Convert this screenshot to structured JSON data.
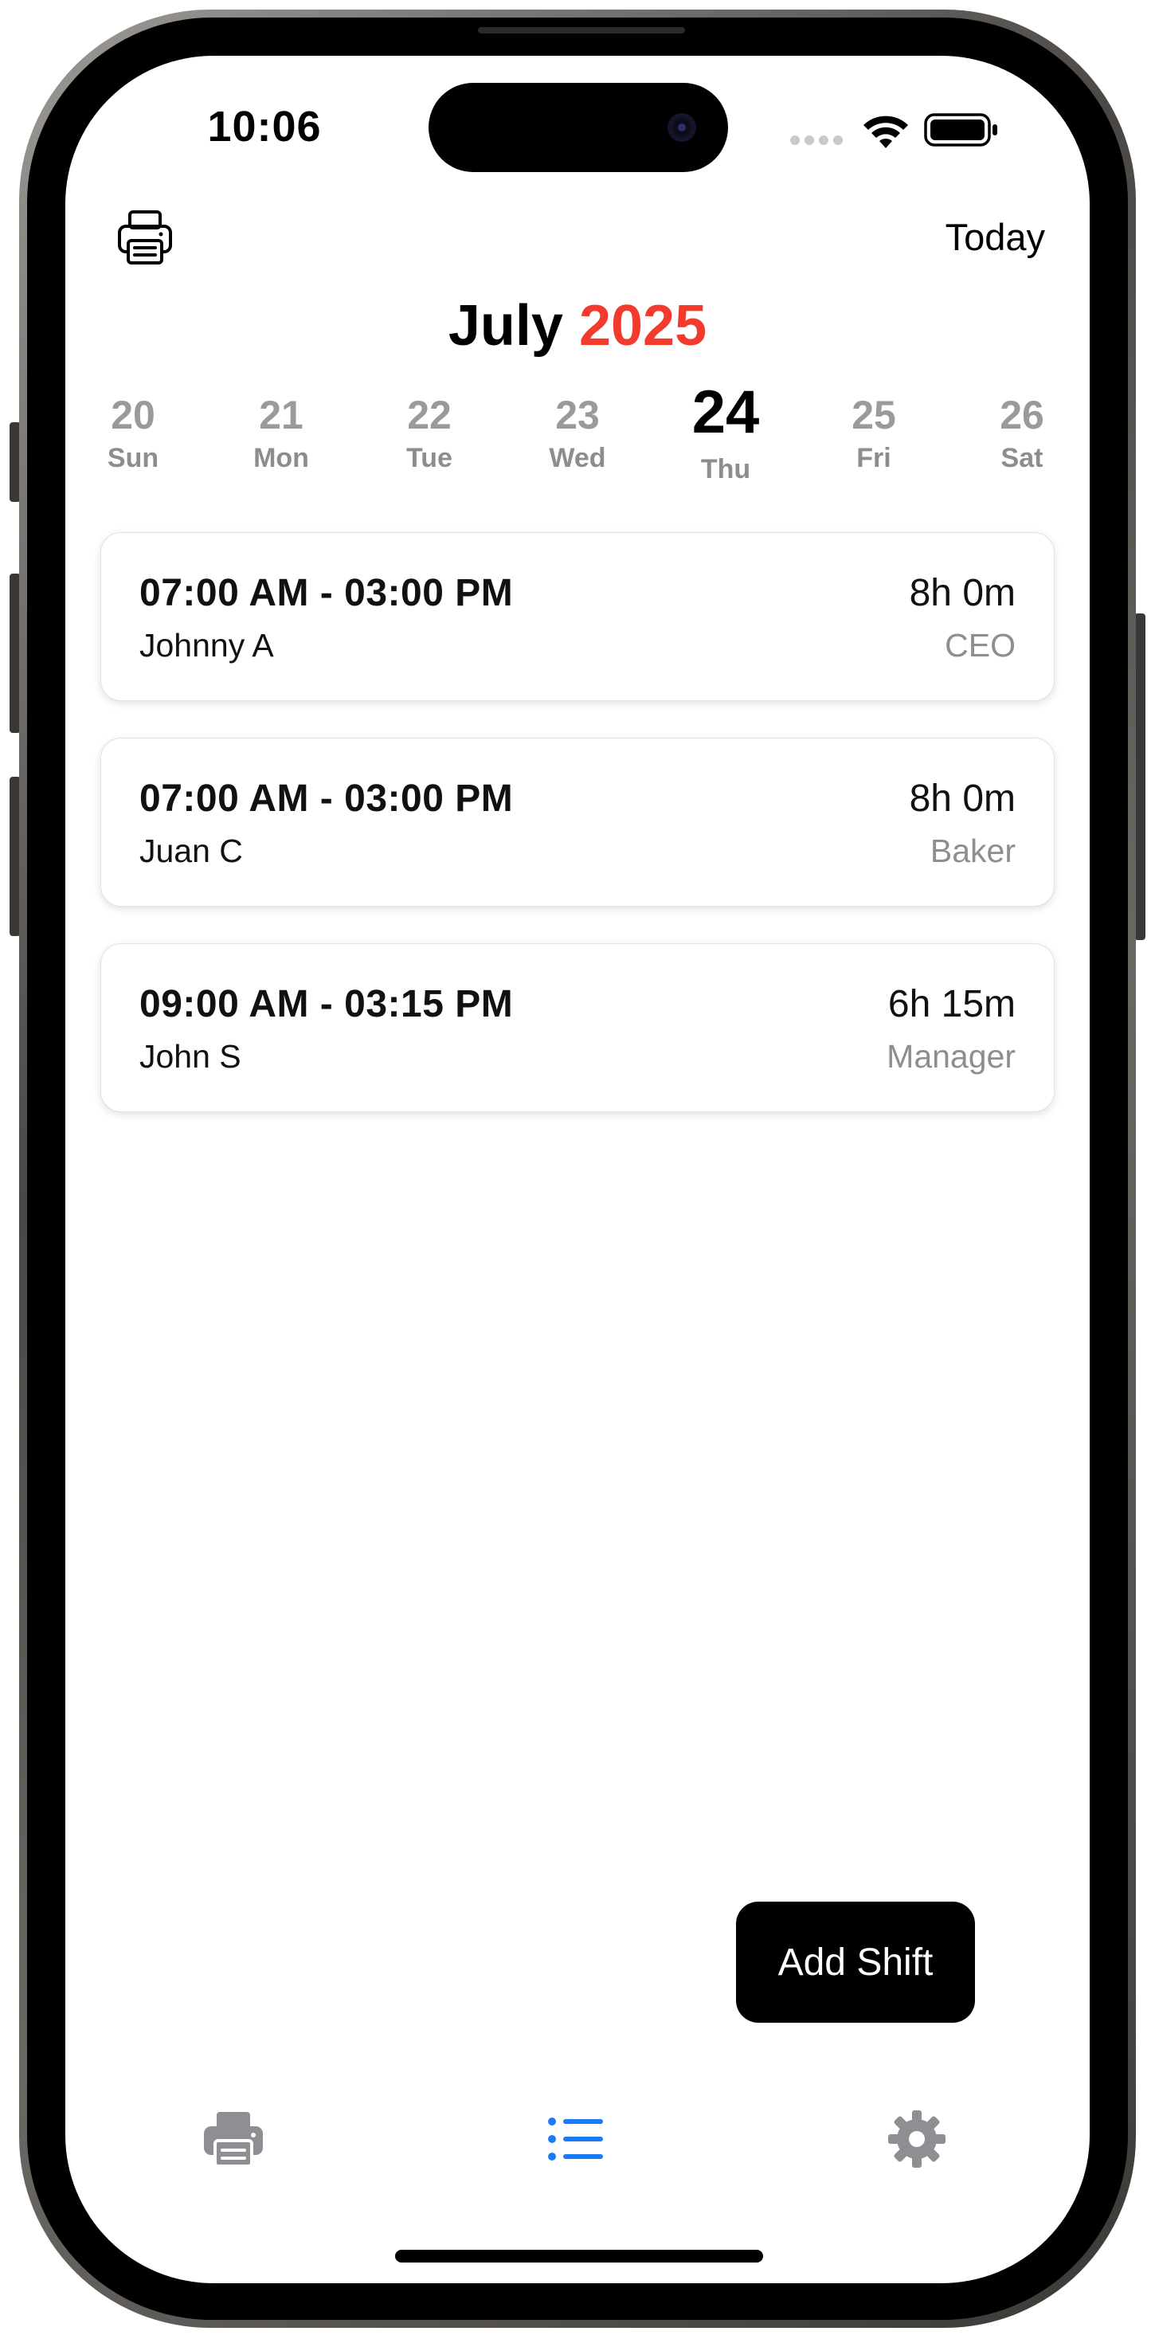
{
  "status_bar": {
    "time": "10:06",
    "icons": [
      "cellular-dots-icon",
      "wifi-icon",
      "battery-icon"
    ]
  },
  "header": {
    "print_icon": "printer-icon",
    "today_label": "Today",
    "month": "July",
    "year": "2025"
  },
  "week": {
    "days": [
      {
        "num": "20",
        "name": "Sun"
      },
      {
        "num": "21",
        "name": "Mon"
      },
      {
        "num": "22",
        "name": "Tue"
      },
      {
        "num": "23",
        "name": "Wed"
      },
      {
        "num": "24",
        "name": "Thu",
        "selected": true
      },
      {
        "num": "25",
        "name": "Fri"
      },
      {
        "num": "26",
        "name": "Sat"
      }
    ]
  },
  "shifts": [
    {
      "time": "07:00 AM - 03:00 PM",
      "name": "Johnny A",
      "duration": "8h 0m",
      "role": "CEO"
    },
    {
      "time": "07:00 AM - 03:00 PM",
      "name": "Juan C",
      "duration": "8h 0m",
      "role": "Baker"
    },
    {
      "time": "09:00 AM - 03:15 PM",
      "name": "John S",
      "duration": "6h 15m",
      "role": "Manager"
    }
  ],
  "add_shift_label": "Add Shift",
  "tab_bar": {
    "tabs": [
      {
        "icon": "printer-icon",
        "active": false
      },
      {
        "icon": "list-icon",
        "active": true
      },
      {
        "icon": "gear-icon",
        "active": false
      }
    ]
  },
  "colors": {
    "accent_red": "#f23b2c",
    "active_tab_blue": "#1a7cf5",
    "inactive_tab_gray": "#8e8e93"
  }
}
